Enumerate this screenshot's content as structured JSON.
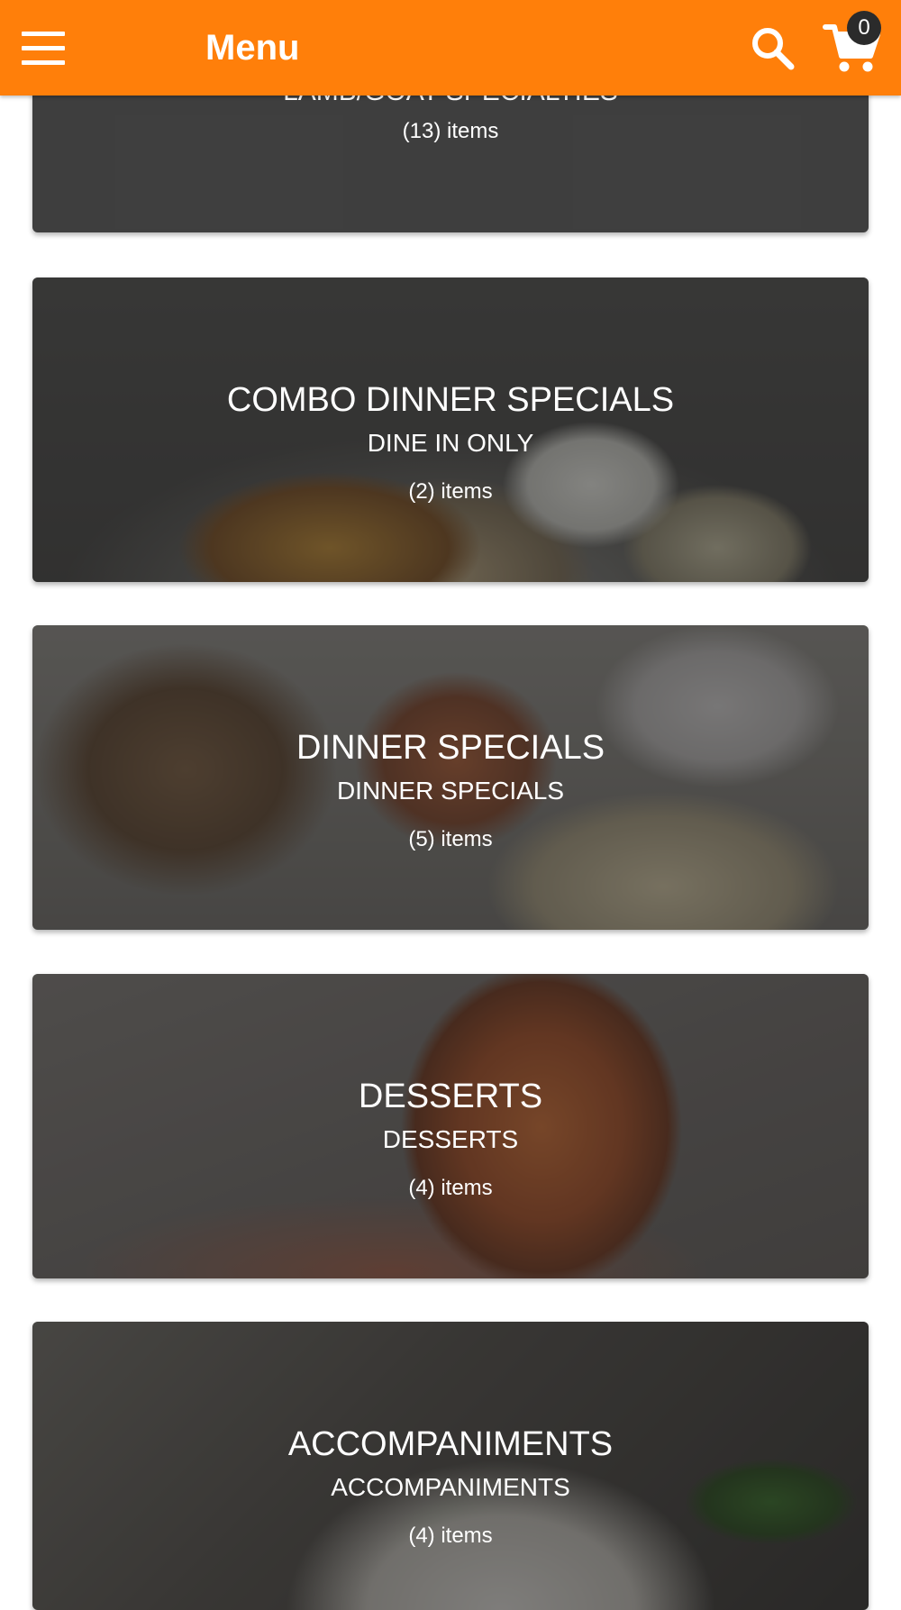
{
  "header": {
    "title": "Menu",
    "cart_count": "0",
    "background_color": "#ff7f0a",
    "icons": [
      "hamburger-menu-icon",
      "search-icon",
      "cart-icon"
    ]
  },
  "categories": [
    {
      "title": "LAMB/GOAT SPECIALTIES",
      "subtitle": "",
      "count": "(13) items"
    },
    {
      "title": "COMBO DINNER SPECIALS",
      "subtitle": "DINE IN ONLY",
      "count": "(2) items"
    },
    {
      "title": "DINNER SPECIALS",
      "subtitle": "DINNER SPECIALS",
      "count": "(5) items"
    },
    {
      "title": "DESSERTS",
      "subtitle": "DESSERTS",
      "count": "(4) items"
    },
    {
      "title": "ACCOMPANIMENTS",
      "subtitle": "ACCOMPANIMENTS",
      "count": "(4) items"
    }
  ]
}
